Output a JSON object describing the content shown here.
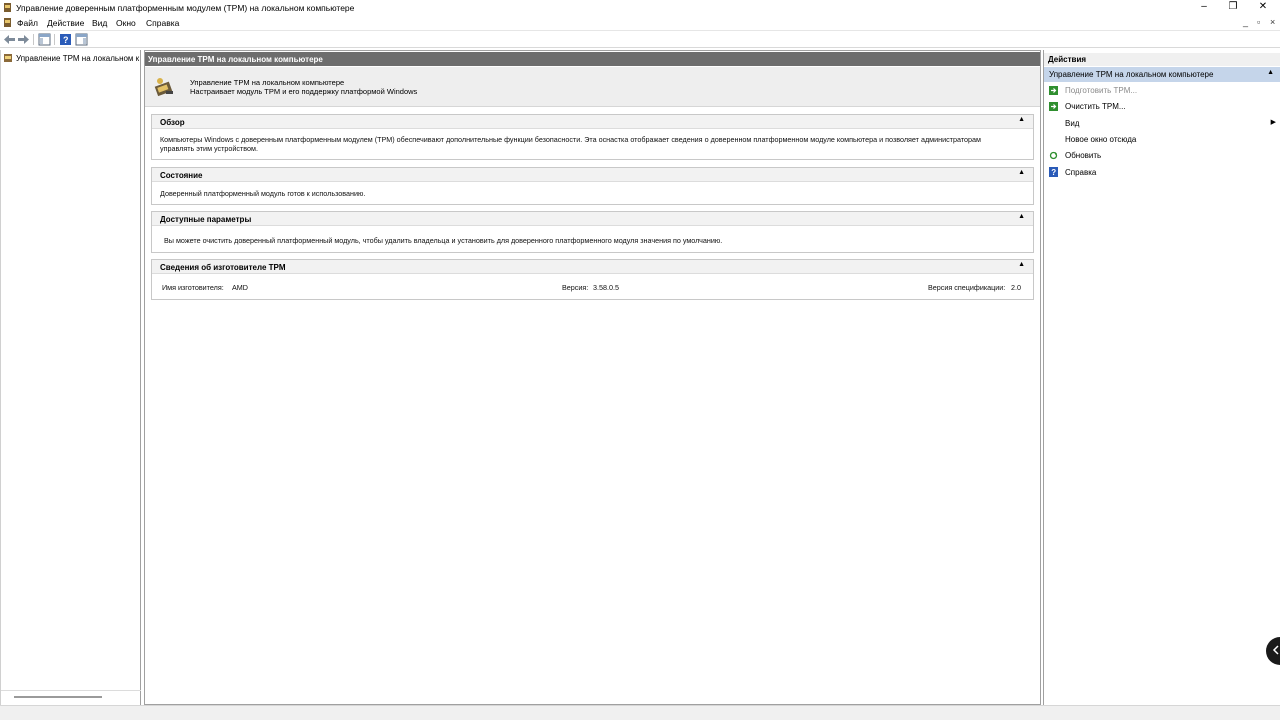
{
  "window": {
    "title": "Управление доверенным платформенным модулем (TPM) на локальном компьютере",
    "controls": {
      "minimize": "–",
      "maximize": "❐",
      "close": "✕"
    }
  },
  "menu": {
    "items": [
      "Файл",
      "Действие",
      "Вид",
      "Окно",
      "Справка"
    ],
    "mdi_controls": {
      "minimize": "_",
      "restore": "▫",
      "close": "×"
    }
  },
  "toolbar": {
    "buttons": [
      "back-icon",
      "forward-icon",
      "show-hide-console-tree-icon",
      "help-icon",
      "show-hide-action-pane-icon"
    ]
  },
  "tree": {
    "root_label": "Управление TPM на локальном к"
  },
  "center": {
    "header": "Управление TPM на локальном компьютере",
    "info_title": "Управление TPM на локальном компьютере",
    "info_subtitle": "Настраивает модуль TPM и его поддержку платформой Windows",
    "collapse_glyph": "▲",
    "sections": {
      "overview": {
        "title": "Обзор",
        "line1": "Компьютеры Windows с доверенным платформенным модулем (TPM) обеспечивают дополнительные функции безопасности. Эта оснастка отображает сведения о доверенном платформенном модуле компьютера и позволяет администраторам",
        "line2": "управлять этим устройством."
      },
      "status": {
        "title": "Состояние",
        "text": "Доверенный платформенный модуль готов к использованию."
      },
      "available": {
        "title": "Доступные параметры",
        "text": "Вы можете очистить доверенный платформенный модуль, чтобы удалить владельца и установить для доверенного платформенного модуля значения по умолчанию."
      },
      "manufacturer": {
        "title": "Сведения об изготовителе TPM",
        "name_label": "Имя изготовителя:",
        "name_value": "AMD",
        "version_label": "Версия:",
        "version_value": "3.58.0.5",
        "spec_label": "Версия спецификации:",
        "spec_value": "2.0"
      }
    }
  },
  "actions": {
    "header": "Действия",
    "group": "Управление TPM на локальном компьютере",
    "items": {
      "prepare": "Подготовить TPM...",
      "clear": "Очистить TPM...",
      "view": "Вид",
      "new_window": "Новое окно отсюда",
      "refresh": "Обновить",
      "help": "Справка"
    }
  },
  "colors": {
    "header_bg": "#6d6d6d",
    "action_group_bg": "#c5d5ea",
    "green_action": "#2f8f2f",
    "help_blue": "#2a5bb8"
  }
}
